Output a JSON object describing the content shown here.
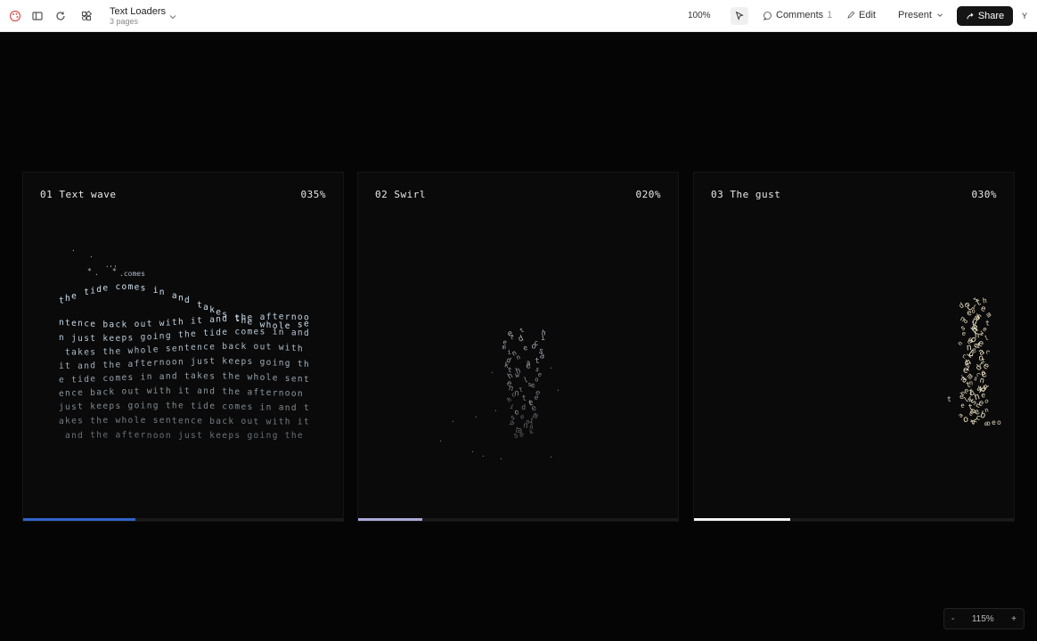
{
  "toolbar": {
    "doc_title": "Text Loaders",
    "doc_subtitle": "3 pages",
    "zoom": "100%",
    "comments_label": "Comments",
    "comments_count": "1",
    "edit_label": "Edit",
    "present_label": "Present",
    "share_label": "Share",
    "avatar_initial": "Y"
  },
  "cards": [
    {
      "title": "01 Text wave",
      "percent": "035%",
      "progress": 0.35,
      "bar_color": "#2f63c9"
    },
    {
      "title": "02 Swirl",
      "percent": "020%",
      "progress": 0.2,
      "bar_color": "#a9a9d8"
    },
    {
      "title": "03 The gust",
      "percent": "030%",
      "progress": 0.3,
      "bar_color": "#f2f2f2"
    }
  ],
  "wave_lines": [
    "the tide comes in and takes the whole se",
    "ntence back out with it and the afternoo",
    "n just keeps going the tide comes in and",
    " takes the whole sentence back out with",
    "it and the afternoon just keeps going th",
    "e tide comes in and takes the whole sent",
    "ence back out with it and the afternoon",
    "just keeps going the tide comes in and t",
    "akes the whole sentence back out with it",
    " and the afternoon just keeps going the"
  ],
  "zoom_control": {
    "minus": "-",
    "value": "115%",
    "plus": "+"
  },
  "colors": {
    "wave_text": "#cfe0f0",
    "gust_text": "#efe3c6",
    "swirl_text": "#c8c8d8"
  }
}
